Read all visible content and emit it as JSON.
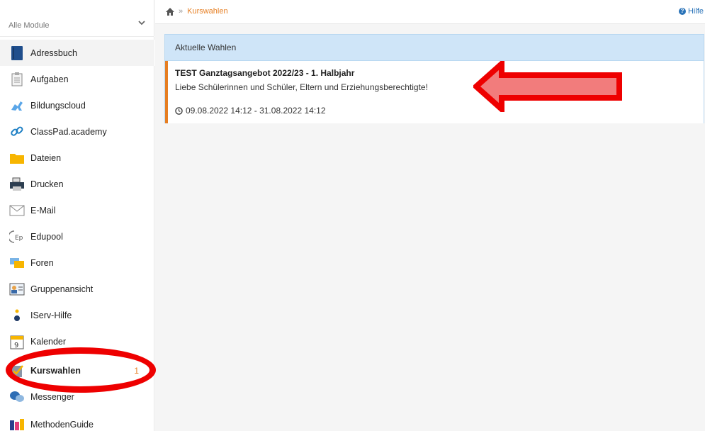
{
  "sidebar": {
    "module_select": {
      "label": "Alle Module",
      "icon": "chevron-down-icon"
    },
    "items": [
      {
        "label": "Adressbuch",
        "icon": "address-book-icon"
      },
      {
        "label": "Aufgaben",
        "icon": "clipboard-icon"
      },
      {
        "label": "Bildungscloud",
        "icon": "cloud-unicorn-icon"
      },
      {
        "label": "ClassPad.academy",
        "icon": "link-icon"
      },
      {
        "label": "Dateien",
        "icon": "folder-icon"
      },
      {
        "label": "Drucken",
        "icon": "printer-icon"
      },
      {
        "label": "E-Mail",
        "icon": "envelope-icon"
      },
      {
        "label": "Edupool",
        "icon": "edupool-icon"
      },
      {
        "label": "Foren",
        "icon": "forum-icon"
      },
      {
        "label": "Gruppenansicht",
        "icon": "group-icon"
      },
      {
        "label": "IServ-Hilfe",
        "icon": "info-icon"
      },
      {
        "label": "Kalender",
        "icon": "calendar-icon",
        "icon_text": "9"
      },
      {
        "label": "Kurswahlen",
        "icon": "checkbox-icon",
        "badge": "1"
      },
      {
        "label": "Messenger",
        "icon": "chat-bubbles-icon"
      },
      {
        "label": "MethodenGuide",
        "icon": "methodenguide-icon"
      }
    ]
  },
  "header": {
    "breadcrumb_sep": "»",
    "breadcrumb_current": "Kurswahlen",
    "help_label": "Hilfe"
  },
  "panel": {
    "title": "Aktuelle Wahlen",
    "entry": {
      "title": "TEST Ganztagsangebot 2022/23 - 1. Halbjahr",
      "description": "Liebe Schülerinnen und Schüler, Eltern und Erziehungsberechtigte!",
      "date_range": "09.08.2022 14:12 - 31.08.2022 14:12"
    }
  },
  "colors": {
    "accent": "#e67e22",
    "panel_header": "#cfe5f8",
    "annotation": "#ee0000",
    "link": "#2a73b8"
  }
}
